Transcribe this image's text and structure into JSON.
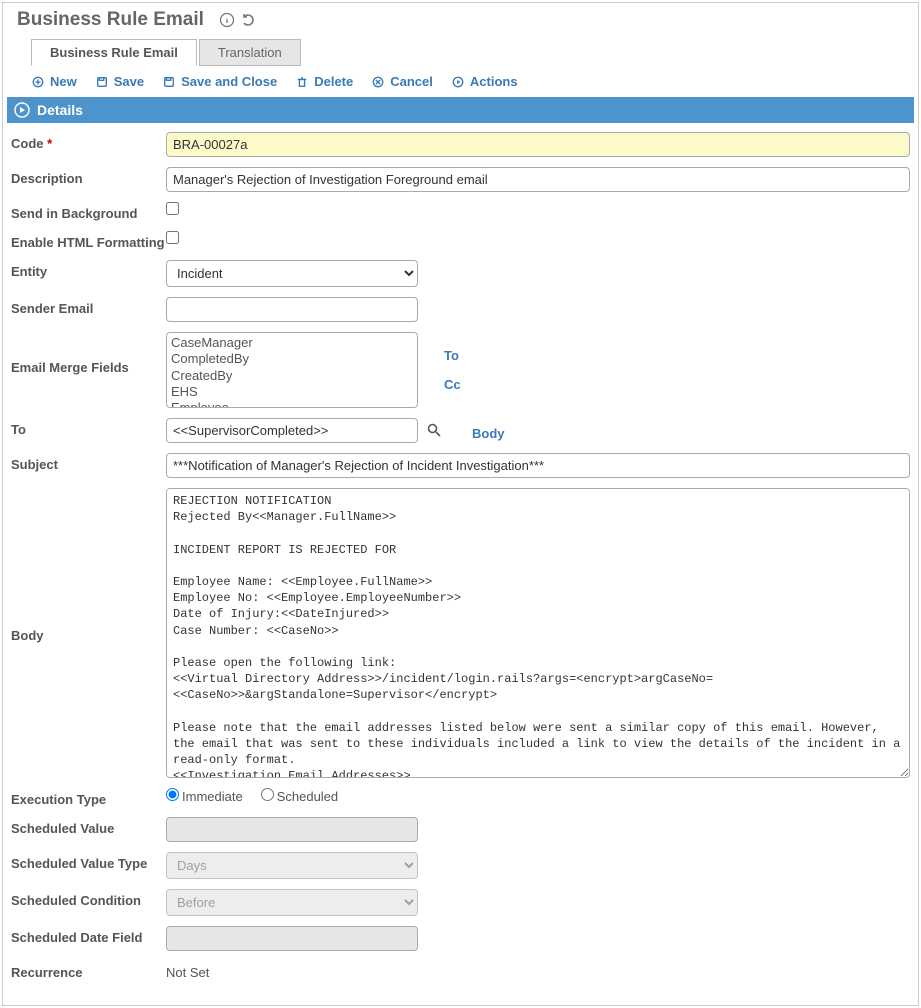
{
  "page": {
    "title": "Business Rule Email"
  },
  "tabs": {
    "main": "Business Rule Email",
    "translation": "Translation"
  },
  "toolbar": {
    "new": "New",
    "save": "Save",
    "saveclose": "Save and Close",
    "delete": "Delete",
    "cancel": "Cancel",
    "actions": "Actions"
  },
  "section": {
    "title": "Details"
  },
  "labels": {
    "code": "Code",
    "description": "Description",
    "sendbg": "Send in Background",
    "enablehtml": "Enable HTML Formatting",
    "entity": "Entity",
    "senderemail": "Sender Email",
    "mergefields": "Email Merge Fields",
    "to": "To",
    "subject": "Subject",
    "body": "Body",
    "exectype": "Execution Type",
    "schedval": "Scheduled Value",
    "schedvaltype": "Scheduled Value Type",
    "schedcond": "Scheduled Condition",
    "scheddatefield": "Scheduled Date Field",
    "recurrence": "Recurrence"
  },
  "fields": {
    "code": "BRA-00027a",
    "description": "Manager's Rejection of Investigation Foreground email",
    "sendbg": false,
    "enablehtml": false,
    "entity": "Incident",
    "senderemail": "",
    "mergefields_options": [
      "CaseManager",
      "CompletedBy",
      "CreatedBy",
      "EHS",
      "Employee"
    ],
    "to": "<<SupervisorCompleted>>",
    "subject": "***Notification of Manager's Rejection of Incident Investigation***",
    "body": "REJECTION NOTIFICATION\nRejected By<<Manager.FullName>>\n\nINCIDENT REPORT IS REJECTED FOR\n\nEmployee Name: <<Employee.FullName>>\nEmployee No: <<Employee.EmployeeNumber>>\nDate of Injury:<<DateInjured>>\nCase Number: <<CaseNo>>\n\nPlease open the following link:\n<<Virtual Directory Address>>/incident/login.rails?args=<encrypt>argCaseNo=\n<<CaseNo>>&argStandalone=Supervisor</encrypt>\n\nPlease note that the email addresses listed below were sent a similar copy of this email. However, the email that was sent to these individuals included a link to view the details of the incident in a read-only format.\n<<Investigation Email Addresses>>",
    "exectype": {
      "immediate": "Immediate",
      "scheduled": "Scheduled",
      "selected": "Immediate"
    },
    "schedval": "",
    "schedvaltype": "Days",
    "schedcond": "Before",
    "scheddatefield": "",
    "recurrence": "Not Set"
  },
  "mergelinks": {
    "to": "To",
    "cc": "Cc",
    "body": "Body"
  }
}
